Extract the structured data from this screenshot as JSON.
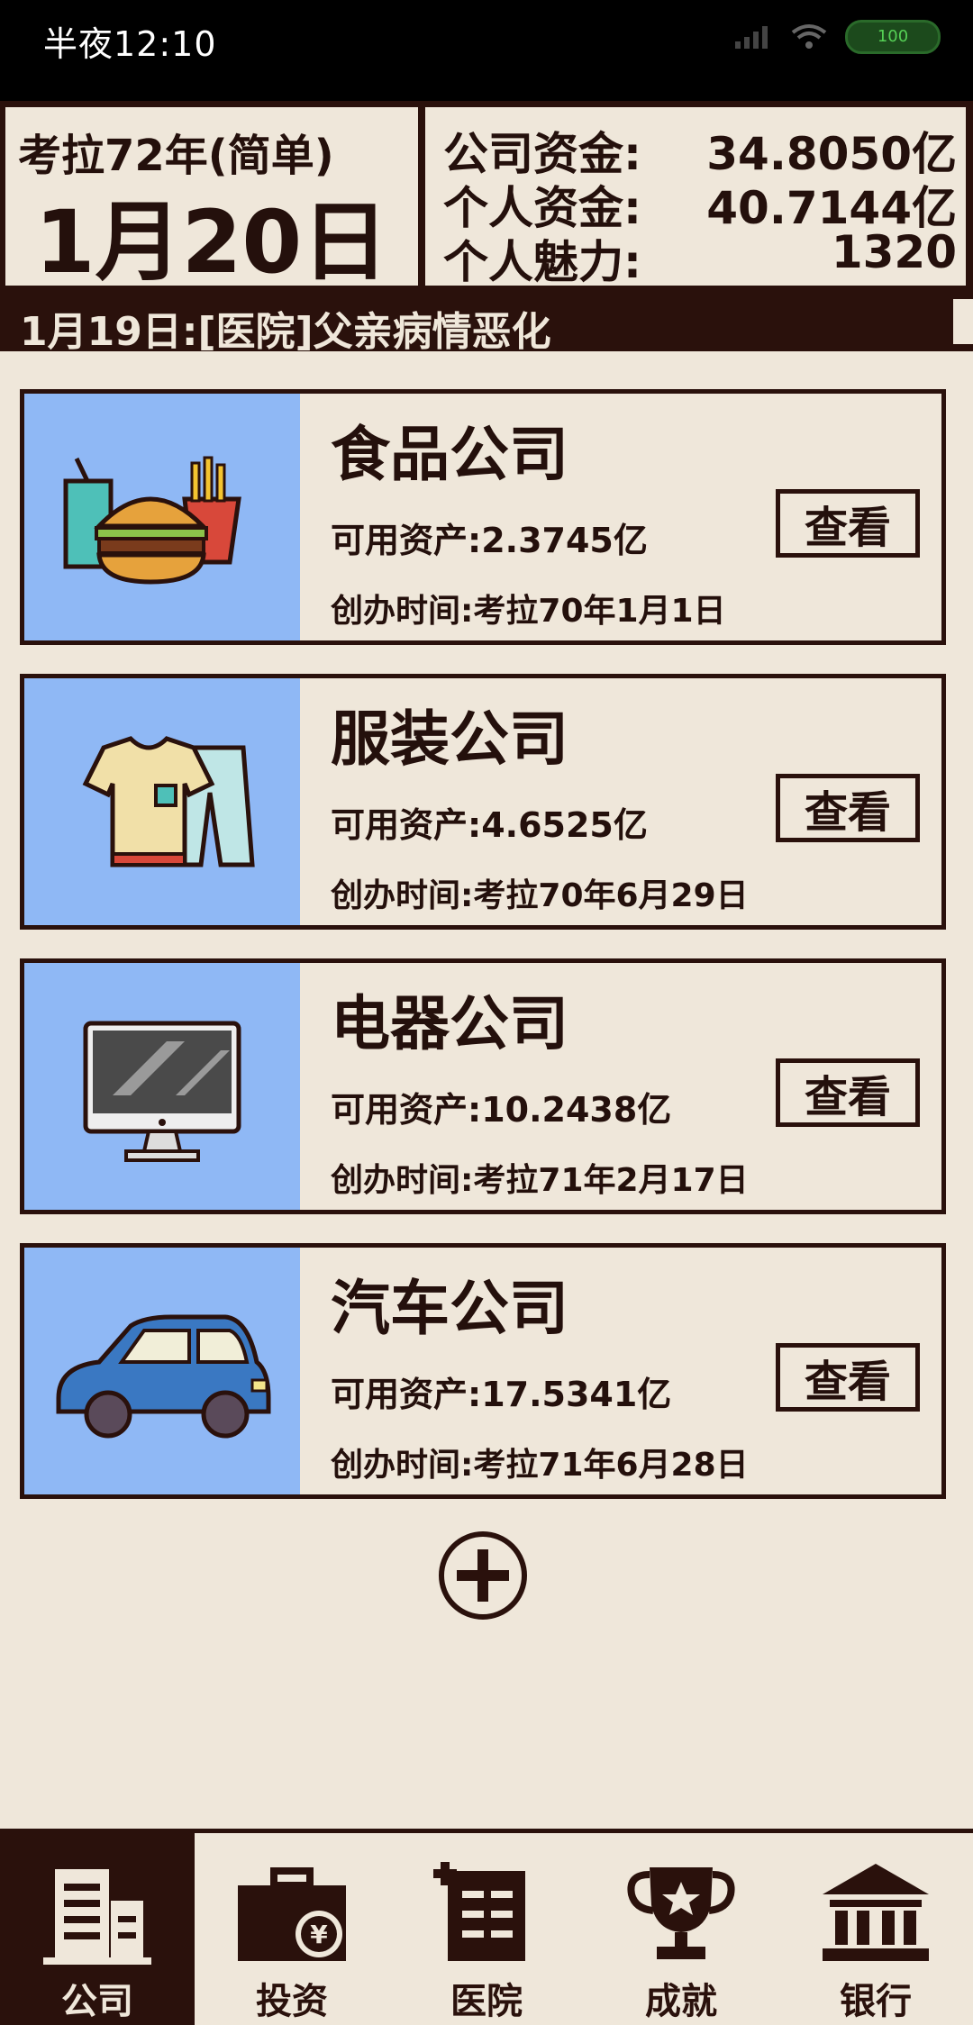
{
  "status": {
    "time": "半夜12:10",
    "battery": "100"
  },
  "header": {
    "era": "考拉72年(简单)",
    "date": "1月20日",
    "funds": [
      {
        "label": "公司资金:",
        "value": "34.8050亿"
      },
      {
        "label": "个人资金:",
        "value": "40.7144亿"
      },
      {
        "label": "个人魅力:",
        "value": "1320"
      }
    ]
  },
  "news": "1月19日:[医院]父亲病情恶化",
  "companies": [
    {
      "name": "食品公司",
      "assets": "可用资产:2.3745亿",
      "founded": "创办时间:考拉70年1月1日",
      "icon": "food-icon"
    },
    {
      "name": "服装公司",
      "assets": "可用资产:4.6525亿",
      "founded": "创办时间:考拉70年6月29日",
      "icon": "clothing-icon"
    },
    {
      "name": "电器公司",
      "assets": "可用资产:10.2438亿",
      "founded": "创办时间:考拉71年2月17日",
      "icon": "monitor-icon"
    },
    {
      "name": "汽车公司",
      "assets": "可用资产:17.5341亿",
      "founded": "创办时间:考拉71年6月28日",
      "icon": "car-icon"
    }
  ],
  "view_label": "查看",
  "nav": [
    {
      "label": "公司",
      "icon": "company-building-icon",
      "active": true
    },
    {
      "label": "投资",
      "icon": "briefcase-icon",
      "active": false
    },
    {
      "label": "医院",
      "icon": "hospital-icon",
      "active": false
    },
    {
      "label": "成就",
      "icon": "trophy-icon",
      "active": false
    },
    {
      "label": "银行",
      "icon": "bank-icon",
      "active": false
    }
  ],
  "colors": {
    "dark": "#2a110c",
    "paper": "#efe7da",
    "thumb_bg": "#8fb8f5"
  }
}
